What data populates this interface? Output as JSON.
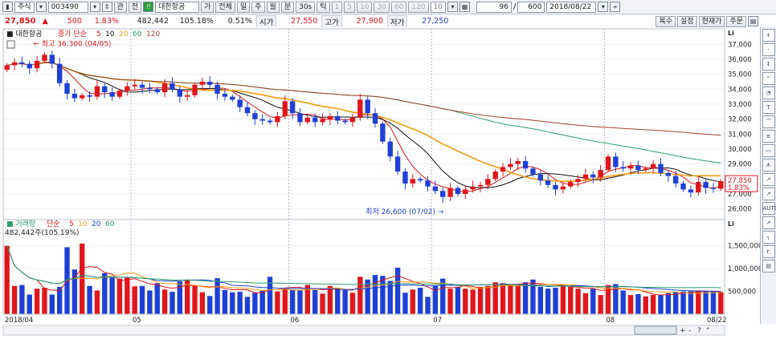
{
  "toolbar": {
    "market": "주식",
    "code": "003490",
    "kwan": "관",
    "jeon": "전",
    "sin": "신용",
    "name": "대한항공",
    "ga": "가",
    "all": "전체",
    "periods": [
      "일",
      "주",
      "월",
      "분",
      "30s",
      "틱"
    ],
    "nums": [
      "1",
      "5",
      "10",
      "30",
      "60",
      "120",
      "10"
    ],
    "shown": "96",
    "sep": "/",
    "total": "600",
    "date": "2018/08/22"
  },
  "quote": {
    "price": "27,850",
    "arrow": "▲",
    "change": "500",
    "pct": "1.83%",
    "volume": "482,442",
    "vol_ratio": "105.18%",
    "turnover": "0.51%",
    "open_label": "시가",
    "open": "27,550",
    "high_label": "고가",
    "high": "27,900",
    "low_label": "저가",
    "low": "27,250",
    "buttons": [
      "복수",
      "설정",
      "현재가",
      "주문"
    ]
  },
  "price_panel": {
    "name": "대한항공",
    "ma_label": "종가 단순",
    "ma": [
      {
        "label": "5",
        "color": "#e0161d"
      },
      {
        "label": "10",
        "color": "#111111"
      },
      {
        "label": "20",
        "color": "#f39c12"
      },
      {
        "label": "60",
        "color": "#2e9e6b"
      },
      {
        "label": "120",
        "color": "#a0412d"
      }
    ],
    "current_price": "27,850",
    "current_pct": "1.83%",
    "high_note": "최고 36,300 (04/05)",
    "low_note": "최저 26,600 (07/02)",
    "axis_prefix": "Li"
  },
  "volume_panel": {
    "label": "거래량",
    "ma_label": "단순",
    "ma": [
      {
        "label": "5",
        "color": "#e0161d"
      },
      {
        "label": "10",
        "color": "#f39c12"
      },
      {
        "label": "20",
        "color": "#1f3fd6"
      },
      {
        "label": "60",
        "color": "#2e9e6b"
      }
    ],
    "value": "482,442주(105.19%)"
  },
  "chart_data": [
    {
      "type": "candlestick",
      "name": "대한항공 일봉",
      "ylim": [
        25500,
        37500
      ],
      "yticks": [
        26000,
        27000,
        28000,
        29000,
        30000,
        31000,
        32000,
        33000,
        34000,
        35000,
        36000,
        37000
      ],
      "x_labels": [
        {
          "label": "2018/04",
          "i": 0
        },
        {
          "label": "05",
          "i": 17
        },
        {
          "label": "06",
          "i": 38
        },
        {
          "label": "07",
          "i": 57
        },
        {
          "label": "08",
          "i": 80
        },
        {
          "label": "08/22",
          "i": 95
        }
      ],
      "closes": [
        35600,
        35800,
        35700,
        35400,
        35900,
        36300,
        35700,
        34400,
        33700,
        33400,
        33600,
        33500,
        34200,
        33800,
        33500,
        33900,
        34200,
        34300,
        34100,
        34000,
        33800,
        34400,
        34000,
        33500,
        33600,
        34300,
        34500,
        34300,
        33700,
        33500,
        33300,
        32800,
        32400,
        32000,
        31900,
        31800,
        32200,
        33200,
        32400,
        31800,
        32100,
        31800,
        32000,
        32200,
        31900,
        31800,
        32100,
        33300,
        32400,
        31700,
        30500,
        29500,
        28500,
        27700,
        28000,
        27900,
        27500,
        27200,
        26800,
        27400,
        27000,
        27300,
        27500,
        27600,
        28000,
        28500,
        28800,
        29000,
        29200,
        28700,
        28300,
        27900,
        27600,
        27300,
        27500,
        27800,
        28000,
        28300,
        28100,
        28600,
        29500,
        28800,
        28700,
        28900,
        28600,
        28700,
        29000,
        28400,
        28200,
        27700,
        27300,
        27100,
        27800,
        27400,
        27350,
        27850
      ],
      "ma": {
        "5": "computed",
        "10": "computed",
        "20": "computed",
        "60": "computed",
        "120": "computed"
      }
    },
    {
      "type": "bar",
      "name": "거래량",
      "ylim": [
        0,
        1900000
      ],
      "yticks": [
        500000,
        1000000,
        1500000
      ],
      "ytick_labels": [
        "500,000",
        "1,000,000",
        "1,500,000"
      ],
      "values": [
        1500000,
        620000,
        640000,
        430000,
        560000,
        580000,
        430000,
        600000,
        1470000,
        980000,
        1550000,
        620000,
        520000,
        900000,
        800000,
        780000,
        800000,
        610000,
        620000,
        520000,
        680000,
        540000,
        490000,
        720000,
        760000,
        620000,
        480000,
        400000,
        790000,
        530000,
        480000,
        490000,
        380000,
        470000,
        520000,
        820000,
        500000,
        560000,
        540000,
        520000,
        640000,
        530000,
        450000,
        620000,
        560000,
        530000,
        470000,
        820000,
        760000,
        860000,
        840000,
        730000,
        1020000,
        470000,
        540000,
        580000,
        380000,
        620000,
        780000,
        560000,
        600000,
        560000,
        540000,
        600000,
        620000,
        700000,
        680000,
        650000,
        640000,
        700000,
        760000,
        600000,
        560000,
        580000,
        640000,
        620000,
        560000,
        460000,
        560000,
        420000,
        640000,
        660000,
        520000,
        420000,
        440000,
        390000,
        420000,
        430000,
        460000,
        480000,
        500000,
        500000,
        520000,
        510000,
        500000,
        482442
      ]
    }
  ],
  "right_toolbar": [
    "+",
    "-",
    "↕",
    "\"",
    "◔",
    "T",
    "⌒",
    "≡",
    "▭",
    "ᗑ",
    "↗",
    "↗",
    "AUTO",
    "↗",
    "┐",
    "ᴦ",
    "▤"
  ],
  "bottom_toolbar": [
    "+",
    "-",
    "?",
    "\"",
    "◔",
    "T",
    "ALL",
    "T",
    "≡"
  ]
}
